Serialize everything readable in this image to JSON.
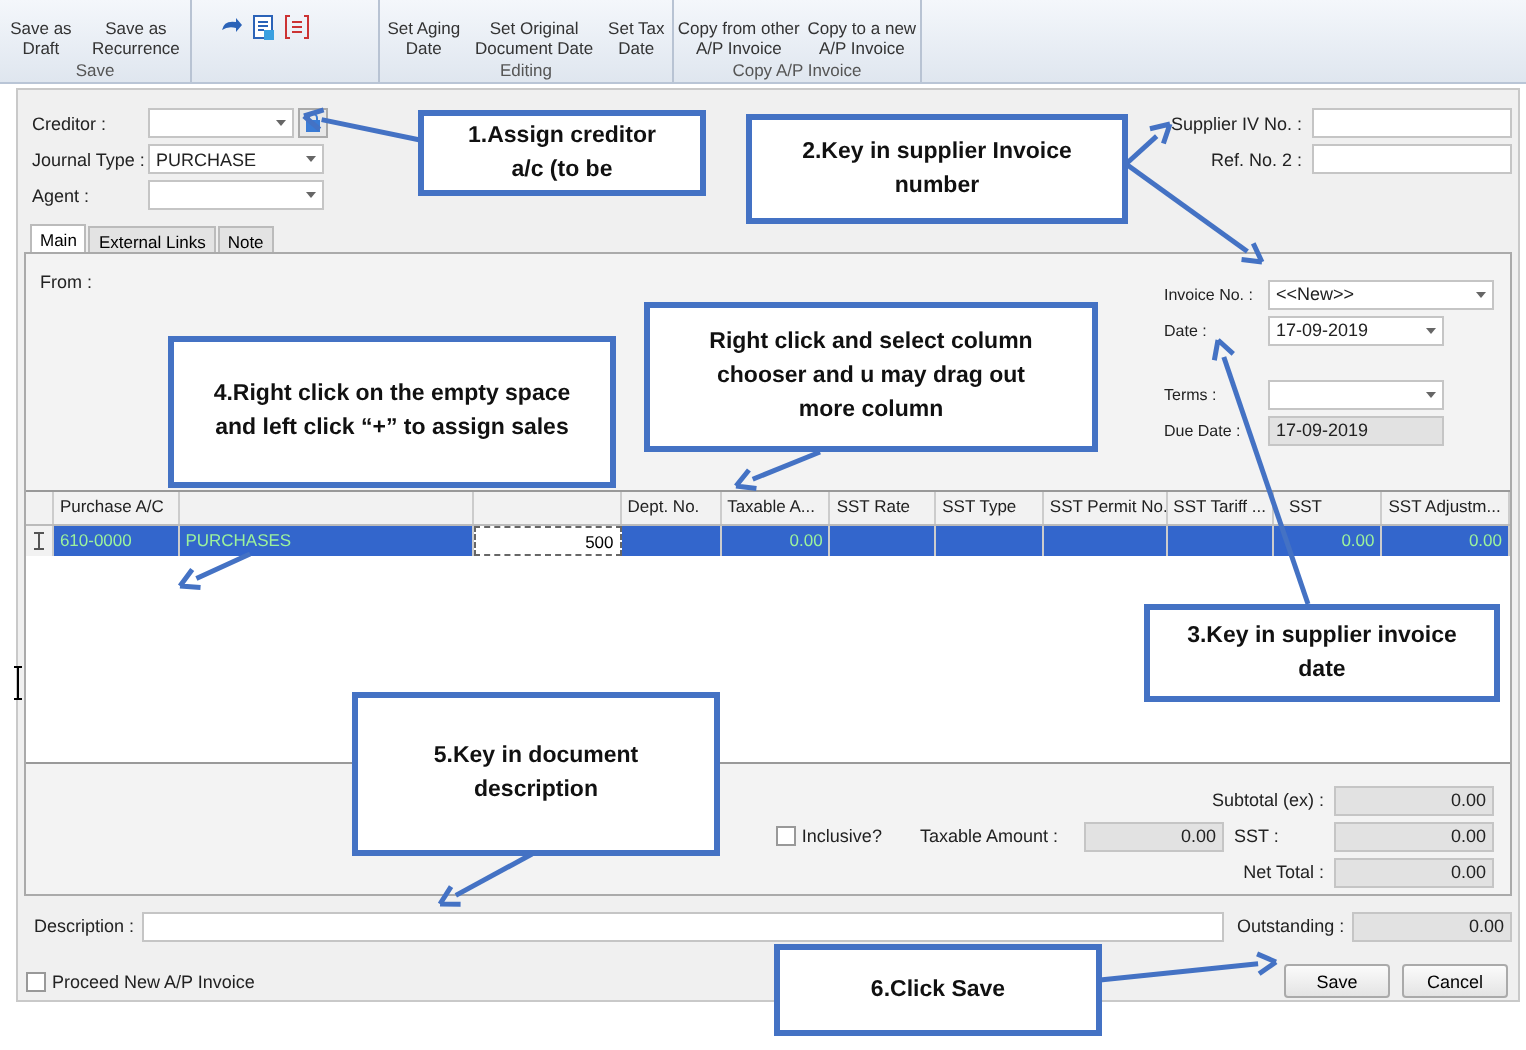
{
  "ribbon": {
    "groups": [
      {
        "title": "Save",
        "buttons": [
          "Save as\nDraft",
          "Save as\nRecurrence"
        ]
      },
      {
        "kind": "icons"
      },
      {
        "title": "Editing",
        "buttons": [
          "Set Aging\nDate",
          "Set Original\nDocument Date",
          "Set Tax\nDate"
        ]
      },
      {
        "title": "Copy A/P Invoice",
        "buttons": [
          "Copy from other\nA/P Invoice",
          "Copy to a new\nA/P Invoice"
        ]
      }
    ]
  },
  "header": {
    "left": [
      {
        "label": "Creditor :",
        "kind": "lookup"
      },
      {
        "label": "Journal Type :",
        "kind": "combo",
        "value": "PURCHASE"
      },
      {
        "label": "Agent :",
        "kind": "combo"
      }
    ],
    "right": [
      {
        "label": "Supplier IV No. :"
      },
      {
        "label": "Ref. No. 2 :"
      }
    ]
  },
  "tabs": [
    {
      "label": "Main",
      "selected": true
    },
    {
      "label": "External Links",
      "selected": false
    },
    {
      "label": "Note",
      "selected": false
    }
  ],
  "main": {
    "from_label": "From :",
    "fields": [
      {
        "label": "Invoice No. :",
        "kind": "wide-combo",
        "value": "<<New>>"
      },
      {
        "label": "Date :",
        "kind": "combo",
        "value": "17-09-2019"
      },
      {
        "label": "Terms :",
        "kind": "combo"
      },
      {
        "label": "Due Date :",
        "kind": "readonly",
        "value": "17-09-2019"
      }
    ]
  },
  "table": {
    "columns": [
      {
        "label": "Purchase A/C"
      },
      {},
      {},
      {
        "label": "Dept. No."
      },
      {
        "label": "Taxable A..."
      },
      {
        "label": "SST Rate"
      },
      {
        "label": "SST Type"
      },
      {
        "label": "SST Permit No."
      },
      {
        "label": "SST Tariff ..."
      },
      {
        "label": "SST"
      },
      {
        "label": "SST Adjustm..."
      }
    ],
    "rows": [
      {
        "selected": true,
        "cells": [
          {
            "text": "610-0000",
            "editing": false
          },
          {
            "text": "PURCHASES",
            "editing": false
          },
          {
            "text": "500",
            "editing": true
          },
          {
            "editing": false
          },
          {
            "text": "0.00",
            "editing": false
          },
          {
            "editing": false
          },
          {
            "editing": false
          },
          {
            "editing": false
          },
          {
            "editing": false
          },
          {
            "text": "0.00",
            "editing": false
          },
          {
            "text": "0.00",
            "editing": false
          }
        ]
      }
    ]
  },
  "totals": {
    "subtotal_label": "Subtotal (ex) :",
    "subtotal": "0.00",
    "inclusive": {
      "label": "Inclusive?",
      "checked": false
    },
    "taxable_label": "Taxable Amount :",
    "taxable": "0.00",
    "sst_label": "SST :",
    "sst": "0.00",
    "net_label": "Net Total :",
    "net": "0.00"
  },
  "description": {
    "label": "Description :",
    "outstanding_label": "Outstanding :",
    "outstanding": "0.00"
  },
  "footer": {
    "proceed": {
      "label": "Proceed New A/P Invoice",
      "checked": false
    },
    "buttons": [
      "Save",
      "Cancel"
    ]
  },
  "callouts": [
    {
      "text": "1.Assign creditor\na/c (to be"
    },
    {
      "text": "2.Key in supplier Invoice\nnumber"
    },
    {
      "text": "Right click and select column\nchooser and u may drag out\nmore column"
    },
    {
      "text": "4.Right click on the empty space\nand left click “+” to assign sales"
    },
    {
      "text": "3.Key in supplier invoice\ndate"
    },
    {
      "text": "5.Key in document\ndescription"
    },
    {
      "text": "6.Click Save"
    }
  ]
}
